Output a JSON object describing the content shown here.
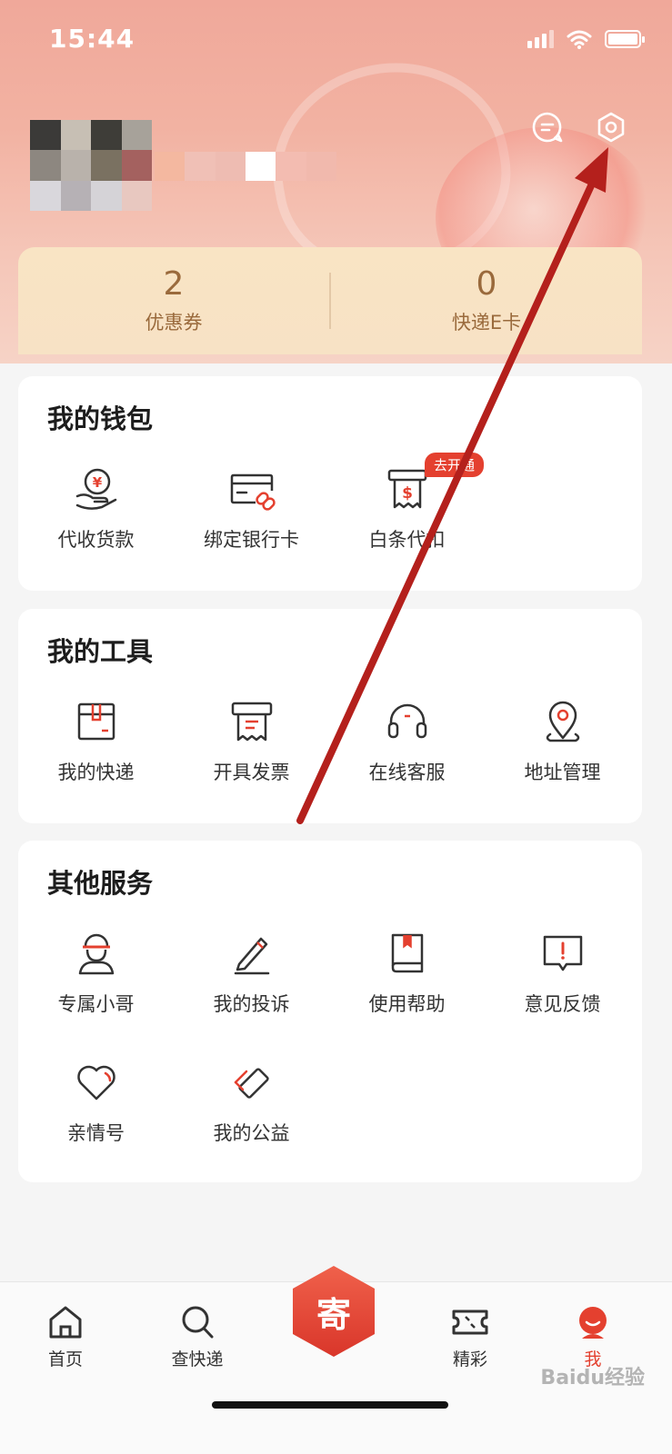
{
  "status_bar": {
    "time": "15:44"
  },
  "header": {
    "message_icon": "message-icon",
    "settings_icon": "settings-gear-icon"
  },
  "stats": [
    {
      "value": "2",
      "label": "优惠券"
    },
    {
      "value": "0",
      "label": "快递E卡"
    }
  ],
  "wallet": {
    "title": "我的钱包",
    "items": [
      {
        "label": "代收货款",
        "icon": "coin-hand-icon"
      },
      {
        "label": "绑定银行卡",
        "icon": "bank-card-link-icon"
      },
      {
        "label": "白条代扣",
        "icon": "receipt-dollar-icon",
        "badge": "去开通"
      }
    ]
  },
  "tools": {
    "title": "我的工具",
    "items": [
      {
        "label": "我的快递",
        "icon": "package-icon"
      },
      {
        "label": "开具发票",
        "icon": "invoice-icon"
      },
      {
        "label": "在线客服",
        "icon": "headset-icon"
      },
      {
        "label": "地址管理",
        "icon": "location-pin-icon"
      }
    ]
  },
  "other": {
    "title": "其他服务",
    "items": [
      {
        "label": "专属小哥",
        "icon": "courier-icon"
      },
      {
        "label": "我的投诉",
        "icon": "pen-icon"
      },
      {
        "label": "使用帮助",
        "icon": "book-icon"
      },
      {
        "label": "意见反馈",
        "icon": "feedback-icon"
      },
      {
        "label": "亲情号",
        "icon": "heart-icon"
      },
      {
        "label": "我的公益",
        "icon": "charity-icon"
      }
    ]
  },
  "tabbar": {
    "items": [
      {
        "label": "首页",
        "icon": "home-icon"
      },
      {
        "label": "查快递",
        "icon": "search-icon"
      },
      {
        "label": "寄",
        "icon": "send-icon"
      },
      {
        "label": "精彩",
        "icon": "ticket-icon"
      },
      {
        "label": "我",
        "icon": "profile-icon",
        "active": true
      }
    ]
  },
  "watermark": "Baidu经验",
  "colors": {
    "accent": "#e4402f",
    "arrow": "#b4201c",
    "stat_text": "#9a6a3c"
  }
}
